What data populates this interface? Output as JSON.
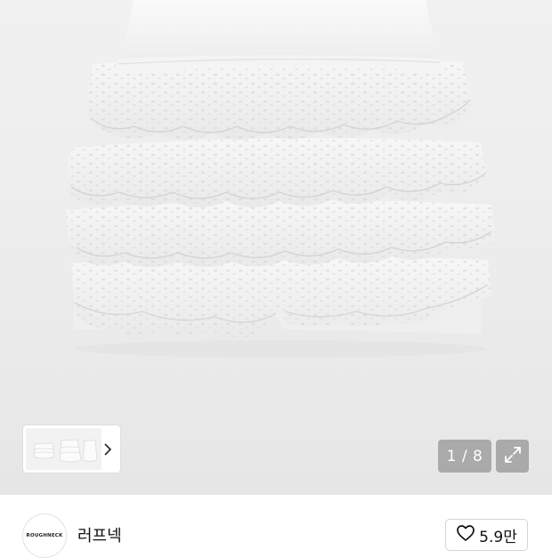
{
  "gallery": {
    "image_alt": "white tiered lace ruffle mini skirt",
    "page_current": "1",
    "page_total": "8",
    "page_counter_text": "1 / 8",
    "icons": {
      "next": "chevron-right-icon",
      "expand": "expand-icon"
    }
  },
  "brand": {
    "logo_text": "ROUGHNECK",
    "name": "러프넥"
  },
  "like": {
    "icon": "heart-outline-icon",
    "count": "5.9만"
  },
  "colors": {
    "gallery_bg": "#ececec",
    "counter_bg": "#8a8a8a",
    "text": "#111111",
    "border": "#d4d4d4"
  }
}
